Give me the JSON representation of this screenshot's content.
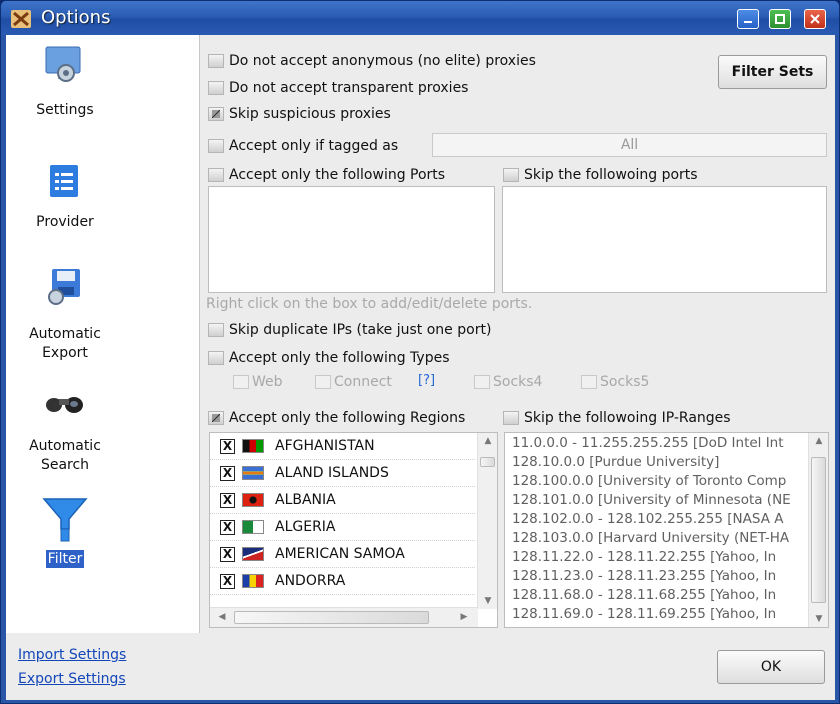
{
  "window": {
    "title": "Options"
  },
  "sidebar": {
    "items": [
      {
        "label": "Settings",
        "icon": "settings-icon"
      },
      {
        "label": "Provider",
        "icon": "provider-icon"
      },
      {
        "label": "Automatic\nExport",
        "icon": "export-icon"
      },
      {
        "label": "Automatic\nSearch",
        "icon": "binoculars-icon"
      },
      {
        "label": "Filter",
        "icon": "filter-funnel-icon",
        "selected": true
      }
    ],
    "links": {
      "import": "Import Settings",
      "export": "Export Settings"
    }
  },
  "filters": {
    "no_anonymous": {
      "label": "Do not accept anonymous (no elite) proxies",
      "checked": false
    },
    "no_transparent": {
      "label": "Do not accept transparent proxies",
      "checked": false
    },
    "skip_suspicious": {
      "label": "Skip suspicious proxies",
      "checked": true
    },
    "tagged": {
      "label": "Accept only if tagged as",
      "checked": false,
      "value": "All"
    },
    "ports_accept": {
      "label": "Accept only the following Ports",
      "checked": false
    },
    "ports_skip": {
      "label": "Skip the followoing ports",
      "checked": false
    },
    "ports_hint": "Right click on the box to add/edit/delete ports.",
    "skip_duplicate": {
      "label": "Skip duplicate IPs (take just one port)",
      "checked": false
    },
    "types": {
      "label": "Accept only the following Types",
      "checked": false,
      "options": [
        "Web",
        "Connect",
        "Socks4",
        "Socks5"
      ],
      "help": "[?]"
    },
    "regions": {
      "label": "Accept only the following Regions",
      "checked": true,
      "items": [
        {
          "name": "AFGHANISTAN",
          "checked": true,
          "mark": "X"
        },
        {
          "name": "ALAND ISLANDS",
          "checked": true,
          "mark": "X"
        },
        {
          "name": "ALBANIA",
          "checked": true,
          "mark": "X"
        },
        {
          "name": "ALGERIA",
          "checked": true,
          "mark": "X"
        },
        {
          "name": "AMERICAN SAMOA",
          "checked": true,
          "mark": "X"
        },
        {
          "name": "ANDORRA",
          "checked": true,
          "mark": "X"
        }
      ]
    },
    "ip_ranges": {
      "label": "Skip the followoing IP-Ranges",
      "checked": false,
      "items": [
        "11.0.0.0 - 11.255.255.255 [DoD Intel Int",
        "128.10.0.0 [Purdue University]",
        "128.100.0.0 [University of Toronto Comp",
        "128.101.0.0 [University of Minnesota (NE",
        "128.102.0.0 - 128.102.255.255 [NASA A",
        "128.103.0.0 [Harvard University (NET-HA",
        "128.11.22.0 - 128.11.22.255 [Yahoo, In",
        "128.11.23.0 - 128.11.23.255 [Yahoo, In",
        "128.11.68.0 - 128.11.68.255 [Yahoo, In",
        "128.11.69.0 - 128.11.69.255 [Yahoo, In"
      ]
    }
  },
  "buttons": {
    "filter_sets": "Filter Sets",
    "ok": "OK"
  }
}
